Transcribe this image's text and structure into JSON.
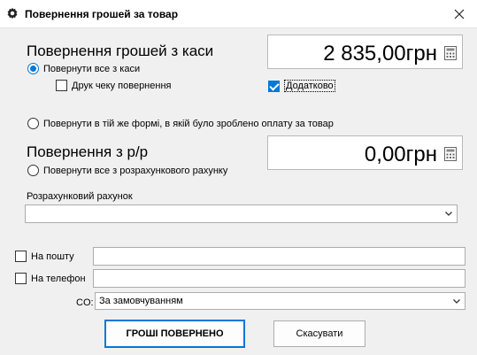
{
  "window": {
    "title": "Повернення грошей за товар"
  },
  "cash": {
    "heading": "Повернення грошей з каси",
    "amount": "2 835,00грн",
    "option_return_all": "Повернути все з каси",
    "option_print_receipt": "Друк чеку повернення",
    "option_additional": "Додатково"
  },
  "same_form": {
    "option_label": "Повернути в тій же формі, в якій було зроблено оплату за товар"
  },
  "bank": {
    "heading": "Повернення з р/р",
    "amount": "0,00грн",
    "option_return_all": "Повернути все з розрахункового рахунку",
    "account_label": "Розрахунковий рахунок",
    "account_value": ""
  },
  "delivery": {
    "mail_label": "На пошту",
    "mail_value": "",
    "phone_label": "На телефон",
    "phone_value": "",
    "co_label": "CO:",
    "co_value": "За замовчуванням"
  },
  "buttons": {
    "confirm": "ГРОШІ ПОВЕРНЕНО",
    "cancel": "Скасувати"
  },
  "colors": {
    "accent": "#0078d7"
  }
}
